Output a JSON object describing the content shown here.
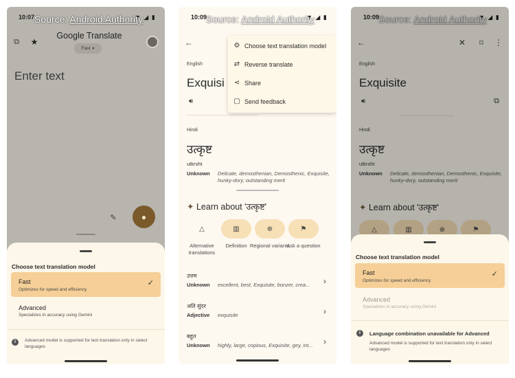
{
  "watermark": {
    "prefix": "Source: ",
    "source": "Android Authority"
  },
  "screen1": {
    "time": "10:07",
    "app_title": "Google Translate",
    "model_pill": "Fast",
    "input_placeholder": "Enter text",
    "sheet": {
      "title": "Choose text translation model",
      "fast": {
        "name": "Fast",
        "desc": "Optimizes for speed and efficiency"
      },
      "advanced": {
        "name": "Advanced",
        "desc": "Specializes in accuracy using Gemini"
      },
      "info": "Advanced model is supported for text translation only in select languages"
    }
  },
  "screen2": {
    "time": "10:09",
    "menu": [
      {
        "label": "Choose text translation model",
        "icon": "gear-icon"
      },
      {
        "label": "Reverse translate",
        "icon": "swap-icon"
      },
      {
        "label": "Share",
        "icon": "share-icon"
      },
      {
        "label": "Send feedback",
        "icon": "feedback-icon"
      }
    ],
    "source_lang": "English",
    "source_word": "Exquisi",
    "target_lang": "Hindi",
    "target_word": "उत्कृष्ट",
    "romanized": "utkrsht",
    "pos": "Unknown",
    "synonyms": "Delicate, demosthenian, Demosthenic, Exquisite, hunky-dory, outstanding merit",
    "learn_title": "Learn about 'उत्कृष्ट'",
    "chips": [
      {
        "label": "Alternative translations",
        "icon": "shapes-icon"
      },
      {
        "label": "Definition",
        "icon": "book-icon"
      },
      {
        "label": "Regional variants",
        "icon": "globe-icon"
      },
      {
        "label": "Ask a question",
        "icon": "question-icon"
      }
    ],
    "rows": [
      {
        "word": "उत्तम",
        "pos": "Unknown",
        "syn": "excellent, best, Exquisite, bonzer, crea..."
      },
      {
        "word": "अति सुंदर",
        "pos": "Adjective",
        "syn": "exquisite"
      },
      {
        "word": "बहुत",
        "pos": "Unknown",
        "syn": "highly, large, copious, Exquisite, gey, int..."
      }
    ]
  },
  "screen3": {
    "time": "10:09",
    "source_lang": "English",
    "source_word": "Exquisite",
    "target_lang": "Hindi",
    "target_word": "उत्कृष्ट",
    "romanized": "utkrsht",
    "pos": "Unknown",
    "synonyms": "Delicate, demosthenian, Demosthenic, Exquisite, hunky-dory, outstanding merit",
    "learn_title": "Learn about 'उत्कृष्ट'",
    "sheet": {
      "title": "Choose text translation model",
      "fast": {
        "name": "Fast",
        "desc": "Optimizes for speed and efficiency"
      },
      "advanced": {
        "name": "Advanced",
        "desc": "Specializes in accuracy using Gemini"
      },
      "warning_title": "Language combination unavailable for Advanced",
      "warning_desc": "Advanced model is supported for text translation only in select languages"
    }
  },
  "colors": {
    "accent": "#f5cf97",
    "sheet": "#fdf7ea",
    "mic": "#7a5a2a"
  }
}
